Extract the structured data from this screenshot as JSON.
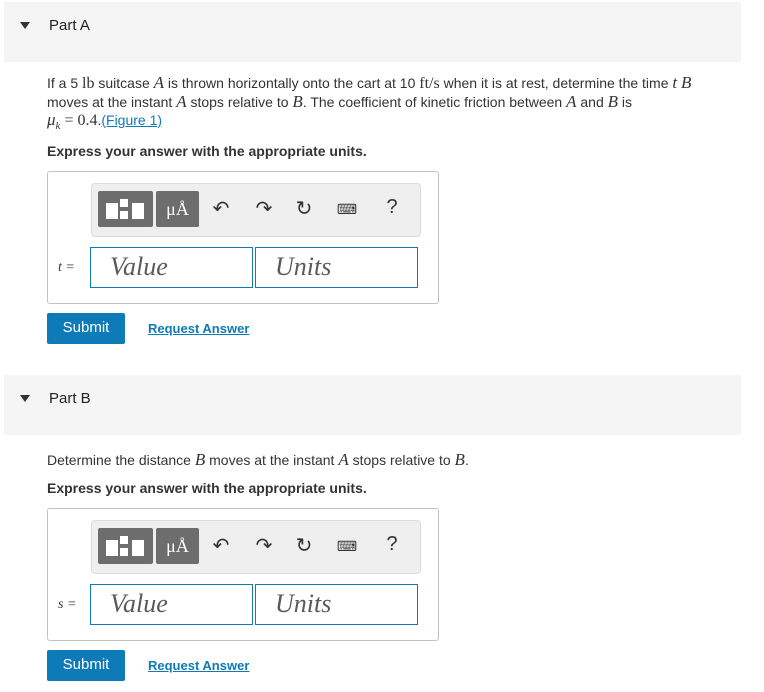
{
  "toolbar": {
    "template_icon": "fraction-template-icon",
    "units_label": "μÅ",
    "undo_icon": "undo-arrow-icon",
    "redo_icon": "redo-arrow-icon",
    "reset_icon": "reset-icon",
    "keyboard_icon": "keyboard-icon",
    "help_label": "?"
  },
  "part_a": {
    "title": "Part A",
    "problem": {
      "t1": "If a 5 ",
      "m1": "lb",
      "t2": " suitcase ",
      "m2": "A",
      "t3": " is thrown horizontally onto the cart at 10 ",
      "m3": "ft/s",
      "t4": " when it is at rest, determine the time ",
      "m4": "t",
      "t5": " ",
      "m5": "B",
      "t6": "moves at the instant ",
      "m6": "A",
      "t7": " stops relative to ",
      "m7": "B",
      "t8": ". The coefficient of kinetic friction between ",
      "m8": "A",
      "t9": " and ",
      "m9": "B",
      "t10": " is",
      "mu": "μ",
      "mu_sub": "k",
      "mu_val": " = 0.4",
      "t11": ".",
      "figure_link": "(Figure 1)",
      "figure_close": ")"
    },
    "instruction": "Express your answer with the appropriate units.",
    "variable": "t =",
    "value_placeholder": "Value",
    "units_placeholder": "Units",
    "submit": "Submit",
    "request": "Request Answer"
  },
  "part_b": {
    "title": "Part B",
    "problem": {
      "t1": "Determine the distance ",
      "m1": "B",
      "t2": " moves at the instant ",
      "m2": "A",
      "t3": " stops relative to ",
      "m3": "B",
      "t4": "."
    },
    "instruction": "Express your answer with the appropriate units.",
    "variable": "s =",
    "value_placeholder": "Value",
    "units_placeholder": "Units",
    "submit": "Submit",
    "request": "Request Answer"
  },
  "colors": {
    "accent": "#0e7ab8",
    "header_bg": "#f5f5f5",
    "toolbar_bg": "#efefef",
    "tool_button": "#6d6d6d"
  }
}
